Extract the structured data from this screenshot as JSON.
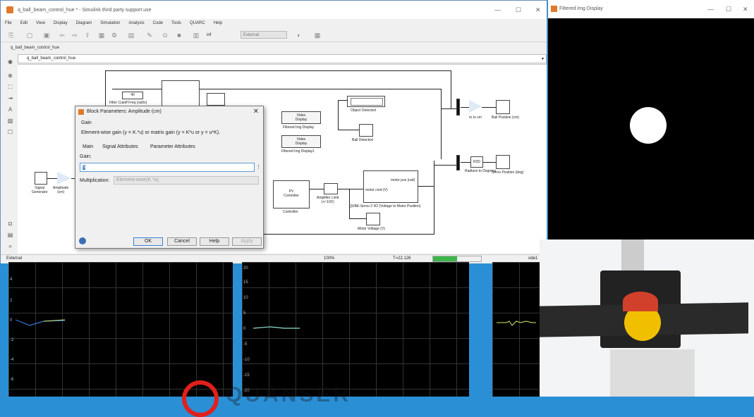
{
  "simulink": {
    "title": "q_ball_beam_control_hue * - Simulink third party support.use",
    "menu": [
      "File",
      "Edit",
      "View",
      "Display",
      "Diagram",
      "Simulation",
      "Analysis",
      "Code",
      "Tools",
      "QUARC",
      "Help"
    ],
    "mode_select": "External",
    "stop_time": "inf",
    "breadcrumb": "q_ball_beam_control_hue",
    "address": "q_ball_beam_control_hue",
    "status": {
      "mode": "External",
      "zoom": "100%",
      "time": "T=22.126",
      "solver": "ode1",
      "progress": 0.5
    },
    "blocks": {
      "filter_value": "40",
      "filter_label": "Filter Cutoff Freq (rad/s)",
      "video_display_1": "Video\nDisplay",
      "filtered_img_display": "Filtered Img Display",
      "filtered_img_display1": "Filtered Img Display1",
      "object_detected": "Object Detected",
      "ball_detected": "Ball Detected",
      "m_to_cm": "m to cm",
      "ball_position": "Ball Position (cm)",
      "r2d": "R2D",
      "radians_to_degrees": "Radians to Degrees",
      "servo_position": "Servo Position (deg)",
      "signal_generator": "Signal\nGenerator",
      "amplitude": "Amplitude\n(cm)",
      "pv_controller": "PV\nController",
      "controller": "Controller",
      "amp_limit": "Amplifier Limit\n(+/-10V)",
      "motor_cmd": "motor cmd (V)",
      "motor_pos": "motor pos (rad)",
      "qube_label": "QUBE-Servo 2 I/O (Voltage to Motor Position)",
      "motor_voltage": "Motor Voltage (V)",
      "video_display": "Video Display"
    }
  },
  "dialog": {
    "title": "Block Parameters: Amplitude (cm)",
    "section": "Gain",
    "description": "Element-wise gain (y = K.*u) or matrix gain (y = K*u or y = u*K).",
    "tabs": [
      "Main",
      "Signal Attributes",
      "Parameter Attributes"
    ],
    "gain_label": "Gain:",
    "gain_value": "5",
    "mult_label": "Multiplication:",
    "mult_value": "Element-wise(K.*u)",
    "buttons": {
      "ok": "OK",
      "cancel": "Cancel",
      "help": "Help",
      "apply": "Apply"
    }
  },
  "image_display": {
    "title": "Filtered Img Display"
  },
  "scopes": {
    "left_ticks": [
      "4",
      "2",
      "0",
      "-2",
      "-4",
      "-6"
    ],
    "mid_ticks": [
      "20",
      "15",
      "10",
      "5",
      "0",
      "-5",
      "-10",
      "-15",
      "-20"
    ],
    "right_ticks": [
      "1",
      "0",
      "-1",
      "-2",
      "-3"
    ]
  },
  "overlay_text": "QUANSER"
}
